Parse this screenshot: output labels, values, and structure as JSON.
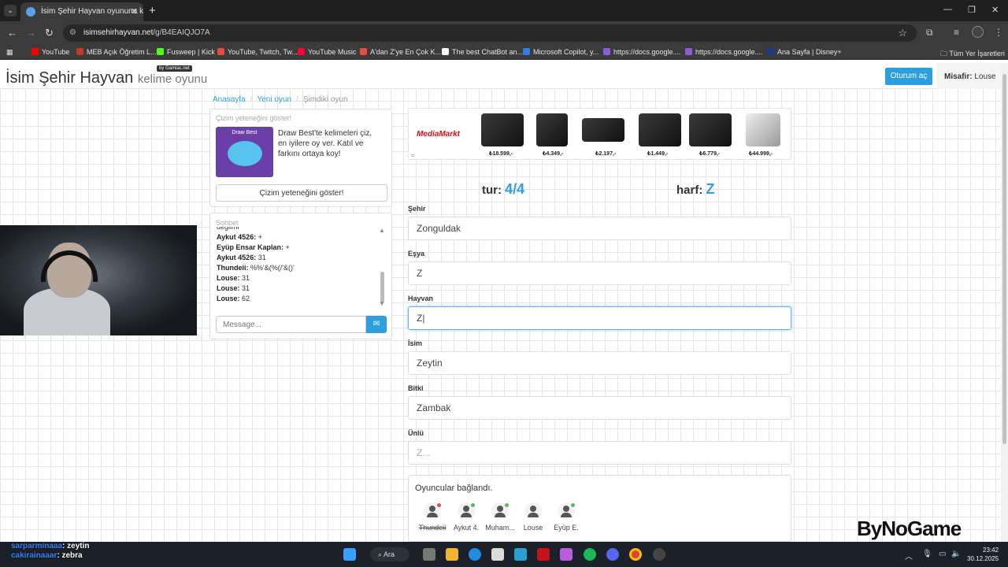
{
  "browser": {
    "tab_title": "İsim Şehir Hayvan oyununa kat",
    "url_host": "isimsehirhayvan.net",
    "url_path": "/g/B4EAIQJO7A",
    "bookmarks": [
      "YouTube",
      "MEB Açık Öğretim L...",
      "Fusweep | Kick",
      "YouTube, Twitch, Tw...",
      "YouTube Music",
      "A'dan Z'ye En Çok K...",
      "The best ChatBot an...",
      "Microsoft Copilot, y...",
      "https://docs.google....",
      "https://docs.google....",
      "Ana Sayfa | Disney+"
    ],
    "bookmark_colors": [
      "#ff0000",
      "#c0392b",
      "#53fc18",
      "#e74c3c",
      "#ff0033",
      "#e74c3c",
      "#ffffff",
      "#2d7fe0",
      "#8e5bd6",
      "#8e5bd6",
      "#1a3a8a"
    ],
    "all_bookmarks": "Tüm Yer İşaretleri"
  },
  "site": {
    "brand": "İsim Şehir Hayvan",
    "brand_sub": "kelime oyunu",
    "badge": "by Gamiac.net",
    "login": "Oturum aç",
    "guest_label": "Misafir:",
    "guest_name": "Louse"
  },
  "breadcrumb": {
    "home": "Anasayfa",
    "new": "Yeni oyun",
    "current": "Şimdiki oyun"
  },
  "promo": {
    "title": "Çizim yeteneğini göster!",
    "image_text": "Draw Best",
    "text": "Draw Best'te kelimeleri çiz, en iyilere oy ver. Katıl ve farkını ortaya koy!",
    "button": "Çizim yeteneğini göster!"
  },
  "chat": {
    "title": "Sohbet",
    "lines": [
      {
        "name": "",
        "msg": "değilmi"
      },
      {
        "name": "Aykut 4526:",
        "msg": "+"
      },
      {
        "name": "Eyüp Ensar Kaplan:",
        "msg": "+"
      },
      {
        "name": "Aykut 4526:",
        "msg": "31"
      },
      {
        "name": "Thundeii:",
        "msg": "%%'&(%(/'&()'"
      },
      {
        "name": "Louse:",
        "msg": "31"
      },
      {
        "name": "Louse:",
        "msg": "31"
      },
      {
        "name": "Louse:",
        "msg": "62"
      }
    ],
    "placeholder": "Message..."
  },
  "ad": {
    "brand": "MediaMarkt",
    "prices": [
      "₺18.599,-",
      "₺4.349,-",
      "₺2.197,-",
      "₺1.449,-",
      "₺6.779,-",
      "₺44.999,-"
    ]
  },
  "game": {
    "round_label": "tur:",
    "round": "4/4",
    "letter_label": "harf:",
    "letter": "Z",
    "fields": [
      {
        "label": "Şehir",
        "value": "Zonguldak"
      },
      {
        "label": "Eşya",
        "value": "Z"
      },
      {
        "label": "Hayvan",
        "value": "Z|"
      },
      {
        "label": "İsim",
        "value": "Zeytin"
      },
      {
        "label": "Bitki",
        "value": "Zambak"
      },
      {
        "label": "Ünlü",
        "value": "",
        "placeholder": "Z..."
      }
    ],
    "players_title": "Oyuncular bağlandı.",
    "players": [
      {
        "name": "Thundeii",
        "status": "red"
      },
      {
        "name": "Aykut 4.",
        "status": "green"
      },
      {
        "name": "Muham...",
        "status": "green"
      },
      {
        "name": "Louse",
        "status": "none"
      },
      {
        "name": "Eyüp E.",
        "status": "green"
      }
    ]
  },
  "watermark": "ByNoGame",
  "stream_chat": [
    {
      "user": "sarparminaaa",
      "msg": ": zeytin"
    },
    {
      "user": "cakirainaaar",
      "msg": ": zebra"
    }
  ],
  "taskbar": {
    "search": "Ara",
    "time": "23:42",
    "date": "30.12.2025"
  }
}
